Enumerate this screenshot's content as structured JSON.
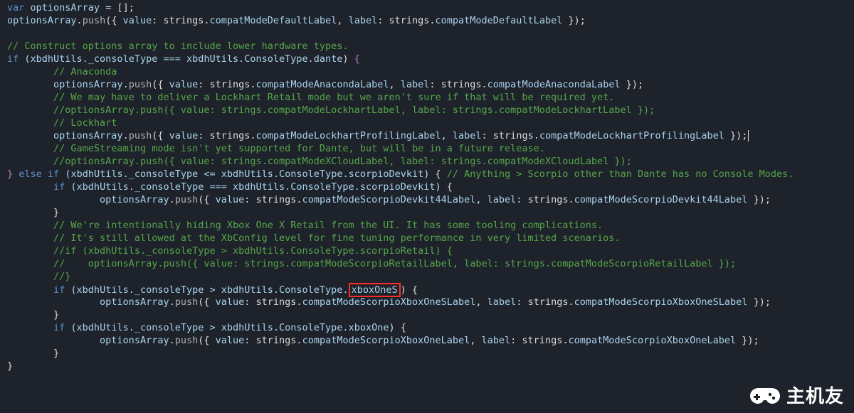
{
  "code": {
    "lines": [
      {
        "indent": 0,
        "spans": [
          {
            "t": "var ",
            "c": "kw"
          },
          {
            "t": "optionsArray ",
            "c": "ident"
          },
          {
            "t": "= [];",
            "c": "punc"
          }
        ]
      },
      {
        "indent": 0,
        "spans": [
          {
            "t": "optionsArray",
            "c": "obj"
          },
          {
            "t": ".",
            "c": "punc"
          },
          {
            "t": "push",
            "c": "method"
          },
          {
            "t": "({ ",
            "c": "punc"
          },
          {
            "t": "value",
            "c": "key"
          },
          {
            "t": ": strings.",
            "c": "punc"
          },
          {
            "t": "compatModeDefaultLabel",
            "c": "ident"
          },
          {
            "t": ", ",
            "c": "punc"
          },
          {
            "t": "label",
            "c": "key"
          },
          {
            "t": ": strings.",
            "c": "punc"
          },
          {
            "t": "compatModeDefaultLabel",
            "c": "ident"
          },
          {
            "t": " });",
            "c": "punc"
          }
        ]
      },
      {
        "indent": 0,
        "spans": [
          {
            "t": " ",
            "c": "txt"
          }
        ]
      },
      {
        "indent": 0,
        "spans": [
          {
            "t": "// Construct options array to include lower hardware types.",
            "c": "cmt"
          }
        ]
      },
      {
        "indent": 0,
        "spans": [
          {
            "t": "if",
            "c": "kw"
          },
          {
            "t": " (xbdhUtils._consoleType === xbdhUtils.ConsoleType.",
            "c": "ident"
          },
          {
            "t": "dante",
            "c": "ident"
          },
          {
            "t": ") ",
            "c": "punc"
          },
          {
            "t": "{",
            "c": "side-brace"
          }
        ]
      },
      {
        "indent": 2,
        "spans": [
          {
            "t": "// Anaconda",
            "c": "cmt"
          }
        ]
      },
      {
        "indent": 2,
        "spans": [
          {
            "t": "optionsArray",
            "c": "obj"
          },
          {
            "t": ".",
            "c": "punc"
          },
          {
            "t": "push",
            "c": "method"
          },
          {
            "t": "({ ",
            "c": "punc"
          },
          {
            "t": "value",
            "c": "key"
          },
          {
            "t": ": strings.",
            "c": "punc"
          },
          {
            "t": "compatModeAnacondaLabel",
            "c": "ident"
          },
          {
            "t": ", ",
            "c": "punc"
          },
          {
            "t": "label",
            "c": "key"
          },
          {
            "t": ": strings.",
            "c": "punc"
          },
          {
            "t": "compatModeAnacondaLabel",
            "c": "ident"
          },
          {
            "t": " });",
            "c": "punc"
          }
        ]
      },
      {
        "indent": 2,
        "spans": [
          {
            "t": "// We may have to deliver a Lockhart Retail mode but we aren't sure if that will be required yet.",
            "c": "cmt"
          }
        ]
      },
      {
        "indent": 2,
        "spans": [
          {
            "t": "//optionsArray.push({ value: strings.compatModeLockhartLabel, label: strings.compatModeLockhartLabel });",
            "c": "cmt"
          }
        ]
      },
      {
        "indent": 2,
        "spans": [
          {
            "t": "// Lockhart",
            "c": "cmt"
          }
        ]
      },
      {
        "indent": 2,
        "spans": [
          {
            "t": "optionsArray",
            "c": "obj"
          },
          {
            "t": ".",
            "c": "punc"
          },
          {
            "t": "push",
            "c": "method"
          },
          {
            "t": "({ ",
            "c": "punc"
          },
          {
            "t": "value",
            "c": "key"
          },
          {
            "t": ": strings.",
            "c": "punc"
          },
          {
            "t": "compatModeLockhartProfilingLabel",
            "c": "ident"
          },
          {
            "t": ", ",
            "c": "punc"
          },
          {
            "t": "label",
            "c": "key"
          },
          {
            "t": ": strings.",
            "c": "punc"
          },
          {
            "t": "compatModeLockhartProfilingLabel",
            "c": "ident"
          },
          {
            "t": " });",
            "c": "punc"
          },
          {
            "t": "",
            "c": "caret"
          }
        ]
      },
      {
        "indent": 2,
        "spans": [
          {
            "t": "// GameStreaming mode isn't yet supported for Dante, but will be in a future release.",
            "c": "cmt"
          }
        ]
      },
      {
        "indent": 2,
        "spans": [
          {
            "t": "//optionsArray.push({ value: strings.compatModeXCloudLabel, label: strings.compatModeXCloudLabel });",
            "c": "cmt"
          }
        ]
      },
      {
        "indent": 0,
        "spans": [
          {
            "t": "}",
            "c": "side-brace"
          },
          {
            "t": " ",
            "c": "txt"
          },
          {
            "t": "else if",
            "c": "kw"
          },
          {
            "t": " (xbdhUtils._consoleType <= xbdhUtils.ConsoleType.",
            "c": "ident"
          },
          {
            "t": "scorpioDevkit",
            "c": "ident"
          },
          {
            "t": ") { ",
            "c": "punc"
          },
          {
            "t": "// Anything > Scorpio other than Dante has no Console Modes.",
            "c": "cmt"
          }
        ]
      },
      {
        "indent": 2,
        "spans": [
          {
            "t": "if",
            "c": "kw"
          },
          {
            "t": " (xbdhUtils._consoleType === xbdhUtils.ConsoleType.",
            "c": "ident"
          },
          {
            "t": "scorpioDevkit",
            "c": "ident"
          },
          {
            "t": ") {",
            "c": "punc"
          }
        ]
      },
      {
        "indent": 4,
        "spans": [
          {
            "t": "optionsArray",
            "c": "obj"
          },
          {
            "t": ".",
            "c": "punc"
          },
          {
            "t": "push",
            "c": "method"
          },
          {
            "t": "({ ",
            "c": "punc"
          },
          {
            "t": "value",
            "c": "key"
          },
          {
            "t": ": strings.",
            "c": "punc"
          },
          {
            "t": "compatModeScorpioDevkit44Label",
            "c": "ident"
          },
          {
            "t": ", ",
            "c": "punc"
          },
          {
            "t": "label",
            "c": "key"
          },
          {
            "t": ": strings.",
            "c": "punc"
          },
          {
            "t": "compatModeScorpioDevkit44Label",
            "c": "ident"
          },
          {
            "t": " });",
            "c": "punc"
          }
        ]
      },
      {
        "indent": 2,
        "spans": [
          {
            "t": "}",
            "c": "punc"
          }
        ]
      },
      {
        "indent": 2,
        "spans": [
          {
            "t": "// We're intentionally hiding Xbox One X Retail from the UI. It has some tooling complications.",
            "c": "cmt"
          }
        ]
      },
      {
        "indent": 2,
        "spans": [
          {
            "t": "// It's still allowed at the XbConfig level for fine tuning performance in very limited scenarios.",
            "c": "cmt"
          }
        ]
      },
      {
        "indent": 2,
        "spans": [
          {
            "t": "//if (xbdhUtils._consoleType > xbdhUtils.ConsoleType.scorpioRetail) {",
            "c": "cmt"
          }
        ]
      },
      {
        "indent": 2,
        "spans": [
          {
            "t": "//    optionsArray.push({ value: strings.compatModeScorpioRetailLabel, label: strings.compatModeScorpioRetailLabel });",
            "c": "cmt"
          }
        ]
      },
      {
        "indent": 2,
        "spans": [
          {
            "t": "//}",
            "c": "cmt"
          }
        ]
      },
      {
        "indent": 2,
        "spans": [
          {
            "t": "if",
            "c": "kw"
          },
          {
            "t": " (xbdhUtils._consoleType > xbdhUtils.ConsoleType.",
            "c": "ident"
          },
          {
            "t": "xboxOneS",
            "c": "ident",
            "box": true
          },
          {
            "t": ") {",
            "c": "punc"
          }
        ]
      },
      {
        "indent": 4,
        "spans": [
          {
            "t": "optionsArray",
            "c": "obj"
          },
          {
            "t": ".",
            "c": "punc"
          },
          {
            "t": "push",
            "c": "method"
          },
          {
            "t": "({ ",
            "c": "punc"
          },
          {
            "t": "value",
            "c": "key"
          },
          {
            "t": ": strings.",
            "c": "punc"
          },
          {
            "t": "compatModeScorpioXboxOneSLabel",
            "c": "ident"
          },
          {
            "t": ", ",
            "c": "punc"
          },
          {
            "t": "label",
            "c": "key"
          },
          {
            "t": ": strings.",
            "c": "punc"
          },
          {
            "t": "compatModeScorpioXboxOneSLabel",
            "c": "ident"
          },
          {
            "t": " });",
            "c": "punc"
          }
        ]
      },
      {
        "indent": 2,
        "spans": [
          {
            "t": "}",
            "c": "punc"
          }
        ]
      },
      {
        "indent": 2,
        "spans": [
          {
            "t": "if",
            "c": "kw"
          },
          {
            "t": " (xbdhUtils._consoleType > xbdhUtils.ConsoleType.",
            "c": "ident"
          },
          {
            "t": "xboxOne",
            "c": "ident"
          },
          {
            "t": ") {",
            "c": "punc"
          }
        ]
      },
      {
        "indent": 4,
        "spans": [
          {
            "t": "optionsArray",
            "c": "obj"
          },
          {
            "t": ".",
            "c": "punc"
          },
          {
            "t": "push",
            "c": "method"
          },
          {
            "t": "({ ",
            "c": "punc"
          },
          {
            "t": "value",
            "c": "key"
          },
          {
            "t": ": strings.",
            "c": "punc"
          },
          {
            "t": "compatModeScorpioXboxOneLabel",
            "c": "ident"
          },
          {
            "t": ", ",
            "c": "punc"
          },
          {
            "t": "label",
            "c": "key"
          },
          {
            "t": ": strings.",
            "c": "punc"
          },
          {
            "t": "compatModeScorpioXboxOneLabel",
            "c": "ident"
          },
          {
            "t": " });",
            "c": "punc"
          }
        ]
      },
      {
        "indent": 2,
        "spans": [
          {
            "t": "}",
            "c": "punc"
          }
        ]
      },
      {
        "indent": 0,
        "spans": [
          {
            "t": "}",
            "c": "punc"
          }
        ]
      }
    ]
  },
  "watermark": {
    "text": "主机友"
  }
}
